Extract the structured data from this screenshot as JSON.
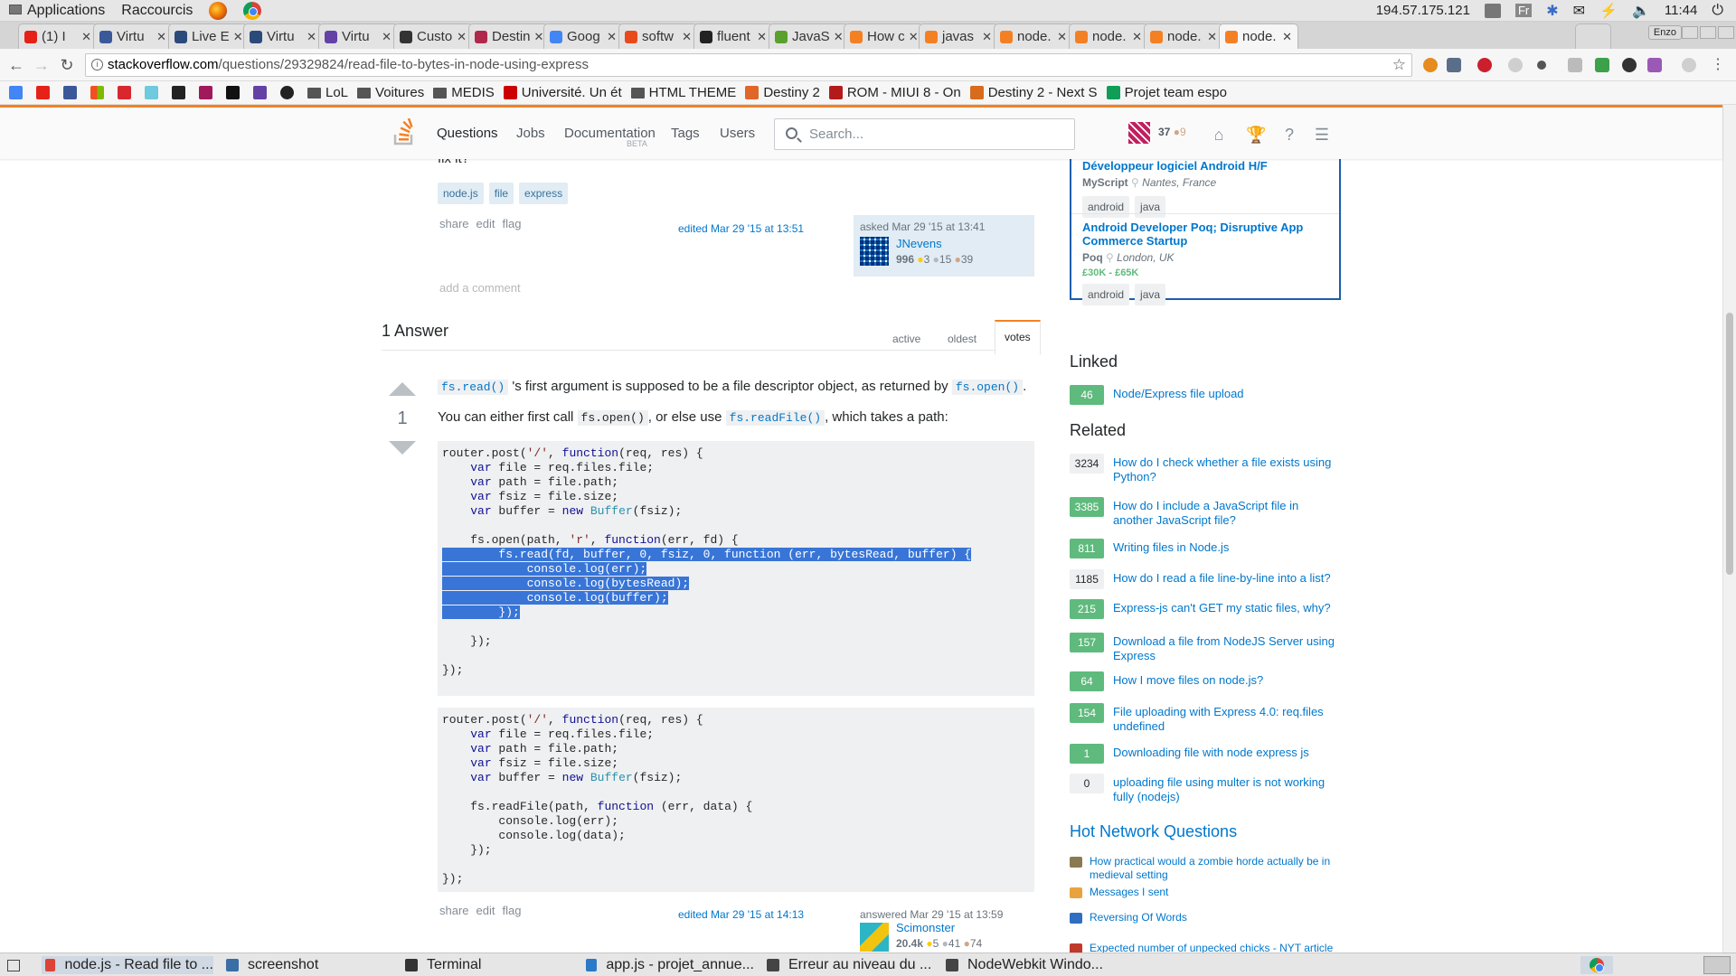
{
  "os": {
    "menu": [
      "Applications",
      "Raccourcis"
    ],
    "ip": "194.57.175.121",
    "lang": "Fr",
    "clock": "11:44"
  },
  "tabs": [
    {
      "label": "(1) I",
      "color": "#e62117"
    },
    {
      "label": "Virtu",
      "color": "#3b5998"
    },
    {
      "label": "Live E",
      "color": "#2b4a7a"
    },
    {
      "label": "Virtu",
      "color": "#2b4a7a"
    },
    {
      "label": "Virtu",
      "color": "#6441a5"
    },
    {
      "label": "Custo",
      "color": "#333333"
    },
    {
      "label": "Destin",
      "color": "#b0284b"
    },
    {
      "label": "Goog",
      "color": "#4285f4"
    },
    {
      "label": "softw",
      "color": "#e94a1b"
    },
    {
      "label": "fluent",
      "color": "#222222"
    },
    {
      "label": "JavaS",
      "color": "#5aa02c"
    },
    {
      "label": "How c",
      "color": "#f48024"
    },
    {
      "label": "javas",
      "color": "#f48024"
    },
    {
      "label": "node.",
      "color": "#f48024"
    },
    {
      "label": "node.",
      "color": "#f48024"
    },
    {
      "label": "node.",
      "color": "#f48024"
    },
    {
      "label": "node.",
      "color": "#f48024"
    }
  ],
  "profile_name": "Enzo",
  "url": {
    "host": "stackoverflow.com",
    "path": "/questions/29329824/read-file-to-bytes-in-node-using-express"
  },
  "bookmarks": [
    {
      "label": "LoL",
      "type": "folder"
    },
    {
      "label": "Voitures",
      "type": "folder"
    },
    {
      "label": "MEDIS",
      "type": "folder"
    },
    {
      "label": "Université. Un ét",
      "type": "site",
      "color": "#cc0000"
    },
    {
      "label": "HTML THEME",
      "type": "folder"
    },
    {
      "label": "Destiny 2",
      "type": "site",
      "color": "#e0662a"
    },
    {
      "label": "ROM - MIUI 8 - On",
      "type": "site",
      "color": "#b31b1b"
    },
    {
      "label": "Destiny 2 - Next S",
      "type": "site",
      "color": "#d96b1c"
    },
    {
      "label": "Projet team espo",
      "type": "site",
      "color": "#0f9d58"
    }
  ],
  "so": {
    "nav": [
      "Questions",
      "Jobs",
      "Documentation",
      "Tags",
      "Users"
    ],
    "beta": "BETA",
    "search_placeholder": "Search...",
    "rep": "37",
    "badges": "9"
  },
  "question": {
    "partial_text": "fix it?",
    "tags": [
      "node.js",
      "file",
      "express"
    ],
    "menu": [
      "share",
      "edit",
      "flag"
    ],
    "edited": "edited Mar 29 '15 at 13:51",
    "asked": "asked Mar 29 '15 at 13:41",
    "user": "JNevens",
    "rep": "996",
    "gold": "3",
    "silver": "15",
    "bronze": "39",
    "add_comment": "add a comment"
  },
  "answers": {
    "count_label": "1 Answer",
    "sort": [
      "active",
      "oldest",
      "votes"
    ]
  },
  "answer": {
    "score": "1",
    "p1_code1": "fs.read()",
    "p1_text1": "'s first argument is supposed to be a file descriptor object, as returned by",
    "p1_code2": "fs.open()",
    "p1_end": ".",
    "p2_text1": "You can either first call",
    "p2_code1": "fs.open()",
    "p2_text2": ", or else use",
    "p2_code2": "fs.readFile()",
    "p2_text3": ", which takes a path:",
    "menu": [
      "share",
      "edit",
      "flag"
    ],
    "edited": "edited Mar 29 '15 at 14:13",
    "answered": "answered Mar 29 '15 at 13:59",
    "user": "Scimonster",
    "rep": "20.4k",
    "gold": "5",
    "silver": "41",
    "bronze": "74"
  },
  "jobs": [
    {
      "title": "Développeur logiciel Android H/F",
      "company": "MyScript",
      "location": "Nantes, France",
      "salary": "",
      "tags": [
        "android",
        "java"
      ]
    },
    {
      "title": "Android Developer Poq; Disruptive App Commerce Startup",
      "company": "Poq",
      "location": "London, UK",
      "salary": "£30K - £65K",
      "tags": [
        "android",
        "java"
      ]
    }
  ],
  "linked": {
    "heading": "Linked",
    "items": [
      {
        "count": "46",
        "title": "Node/Express file upload",
        "accepted": true
      }
    ]
  },
  "related": {
    "heading": "Related",
    "items": [
      {
        "count": "3234",
        "title": "How do I check whether a file exists using Python?",
        "accepted": false
      },
      {
        "count": "3385",
        "title": "How do I include a JavaScript file in another JavaScript file?",
        "accepted": true
      },
      {
        "count": "811",
        "title": "Writing files in Node.js",
        "accepted": true
      },
      {
        "count": "1185",
        "title": "How do I read a file line-by-line into a list?",
        "accepted": false
      },
      {
        "count": "215",
        "title": "Express-js can't GET my static files, why?",
        "accepted": true
      },
      {
        "count": "157",
        "title": "Download a file from NodeJS Server using Express",
        "accepted": true
      },
      {
        "count": "64",
        "title": "How I move files on node.js?",
        "accepted": true
      },
      {
        "count": "154",
        "title": "File uploading with Express 4.0: req.files undefined",
        "accepted": true
      },
      {
        "count": "1",
        "title": "Downloading file with node express js",
        "accepted": true
      },
      {
        "count": "0",
        "title": "uploading file using multer is not working fully (nodejs)",
        "accepted": false
      }
    ]
  },
  "hnq": {
    "heading": "Hot Network Questions",
    "items": [
      {
        "title": "How practical would a zombie horde actually be in medieval setting",
        "color": "#8a7a52"
      },
      {
        "title": "Messages I sent",
        "color": "#e8a33d"
      },
      {
        "title": "Reversing Of Words",
        "color": "#2f6ec0"
      },
      {
        "title": "Expected number of unpecked chicks - NYT article",
        "color": "#c0392b"
      }
    ]
  },
  "taskbar": [
    {
      "label": "node.js - Read file to ...",
      "color": "#db4437",
      "active": true
    },
    {
      "label": "screenshot",
      "color": "#3a6ea5",
      "active": false
    },
    {
      "label": "Terminal",
      "color": "#333333",
      "active": false
    },
    {
      "label": "app.js - projet_annue...",
      "color": "#2a7ac8",
      "active": false
    },
    {
      "label": "Erreur au niveau du ...",
      "color": "#444444",
      "active": false
    },
    {
      "label": "NodeWebkit Windo...",
      "color": "#444444",
      "active": false
    }
  ]
}
